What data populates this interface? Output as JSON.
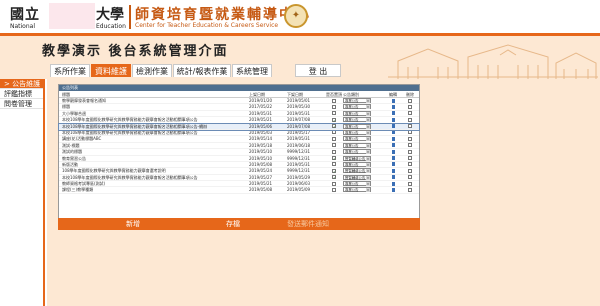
{
  "header": {
    "school_left": "國立",
    "school_left_en": "National",
    "school_right": "大學",
    "school_right_en": "Education",
    "center_name": "師資培育暨就業輔導中心",
    "center_name_en": "Center for Teacher Education & Careers Service"
  },
  "page_title": "教學演示 後台系統管理介面",
  "tabs": [
    {
      "label": "系所作業",
      "active": false
    },
    {
      "label": "資料維護",
      "active": true
    },
    {
      "label": "檢測作業",
      "active": false
    },
    {
      "label": "統計/報表作業",
      "active": false
    },
    {
      "label": "系統管理",
      "active": false
    }
  ],
  "logout_label": "登 出",
  "sidebar": {
    "items": [
      {
        "label": "公告維護",
        "active": true,
        "marker": "> "
      },
      {
        "label": "評鑑指標",
        "active": false,
        "marker": ""
      },
      {
        "label": "問卷管理",
        "active": false,
        "marker": ""
      }
    ]
  },
  "panel": {
    "title": "公告列表",
    "columns": [
      "標題",
      "上架日期",
      "下架日期",
      "是否置頂",
      "公告類別",
      "編輯",
      "刪除"
    ],
    "rows": [
      {
        "title": "教學觀摩發表會報名通知",
        "start": "2019/01/20",
        "end": "2019/05/01",
        "top": false,
        "cat": "專業公告",
        "hl": false
      },
      {
        "title": "標題",
        "start": "2017/05/22",
        "end": "2019/05/30",
        "top": false,
        "cat": "專業公告",
        "hl": false
      },
      {
        "title": "大小學聯合週",
        "start": "2019/05/31",
        "end": "2019/05/31",
        "top": false,
        "cat": "專業公告",
        "hl": false
      },
      {
        "title": "本校108學年度國際化教學研究與教學實務能力觀摩會報名活動相關事項公告",
        "start": "2019/05/21",
        "end": "2019/07/08",
        "top": true,
        "cat": "專業公告",
        "hl": false
      },
      {
        "title": "本校108學年度國際化教學研究與教學實務能力觀摩會報名活動相關事項公告-續辦",
        "start": "2019/05/06",
        "end": "2019/07/08",
        "top": true,
        "cat": "專業公告",
        "hl": true
      },
      {
        "title": "本校108學年度國際化教學研究與教學實務能力觀摩會報名活動相關事項公告",
        "start": "2019/05/03",
        "end": "2019/05/17",
        "top": false,
        "cat": "專業公告",
        "hl": false
      },
      {
        "title": "講座(花)活動標題ABC",
        "start": "2019/05/14",
        "end": "2019/05/31",
        "top": false,
        "cat": "專業公告",
        "hl": false
      },
      {
        "title": "測試-標題",
        "start": "2019/05/18",
        "end": "2019/06/18",
        "top": false,
        "cat": "專業公告",
        "hl": false
      },
      {
        "title": "測試的標題",
        "start": "2019/05/10",
        "end": "9999/12/31",
        "top": false,
        "cat": "專業公告",
        "hl": false
      },
      {
        "title": "教育實習公告",
        "start": "2019/05/10",
        "end": "9999/12/31",
        "top": true,
        "cat": "實習輔導公告",
        "hl": false
      },
      {
        "title": "新版活動",
        "start": "2019/05/08",
        "end": "2019/05/31",
        "top": false,
        "cat": "專業公告",
        "hl": false
      },
      {
        "title": "108學年度國際化教學研究與教學實務能力觀摩會選考說明",
        "start": "2019/05/24",
        "end": "9999/12/31",
        "top": true,
        "cat": "實習輔導公告",
        "hl": false
      },
      {
        "title": "本校108學年度國際化教學研究與教學實務能力觀摩會報名活動相關事項公告",
        "start": "2019/05/27",
        "end": "2019/05/29",
        "top": true,
        "cat": "實習輔導公告",
        "hl": false
      },
      {
        "title": "教師資格考試專區(測試)",
        "start": "2019/05/21",
        "end": "2019/06/03",
        "top": false,
        "cat": "專業公告",
        "hl": false
      },
      {
        "title": "課程(三)教學種類",
        "start": "2019/05/08",
        "end": "2019/05/09",
        "top": false,
        "cat": "專業公告",
        "hl": false
      }
    ]
  },
  "buttons": {
    "add": "新增",
    "save": "存檔",
    "send_mail": "發送郵件通知"
  },
  "colors": {
    "accent": "#e6671a",
    "band": "#fde8d3",
    "panel_header": "#4f6f8f"
  }
}
